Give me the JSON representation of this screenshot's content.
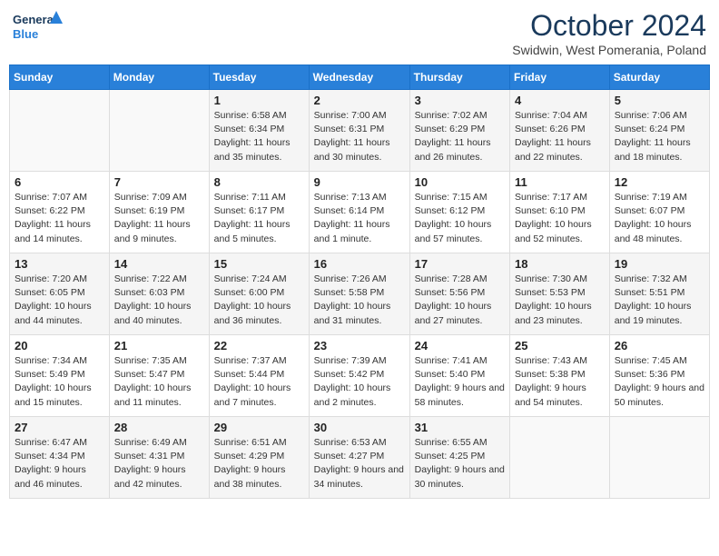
{
  "header": {
    "logo": {
      "general": "General",
      "blue": "Blue"
    },
    "title": "October 2024",
    "subtitle": "Swidwin, West Pomerania, Poland"
  },
  "days_of_week": [
    "Sunday",
    "Monday",
    "Tuesday",
    "Wednesday",
    "Thursday",
    "Friday",
    "Saturday"
  ],
  "weeks": [
    [
      null,
      null,
      {
        "day": 1,
        "sunrise": "6:58 AM",
        "sunset": "6:34 PM",
        "daylight": "11 hours and 35 minutes."
      },
      {
        "day": 2,
        "sunrise": "7:00 AM",
        "sunset": "6:31 PM",
        "daylight": "11 hours and 30 minutes."
      },
      {
        "day": 3,
        "sunrise": "7:02 AM",
        "sunset": "6:29 PM",
        "daylight": "11 hours and 26 minutes."
      },
      {
        "day": 4,
        "sunrise": "7:04 AM",
        "sunset": "6:26 PM",
        "daylight": "11 hours and 22 minutes."
      },
      {
        "day": 5,
        "sunrise": "7:06 AM",
        "sunset": "6:24 PM",
        "daylight": "11 hours and 18 minutes."
      }
    ],
    [
      {
        "day": 6,
        "sunrise": "7:07 AM",
        "sunset": "6:22 PM",
        "daylight": "11 hours and 14 minutes."
      },
      {
        "day": 7,
        "sunrise": "7:09 AM",
        "sunset": "6:19 PM",
        "daylight": "11 hours and 9 minutes."
      },
      {
        "day": 8,
        "sunrise": "7:11 AM",
        "sunset": "6:17 PM",
        "daylight": "11 hours and 5 minutes."
      },
      {
        "day": 9,
        "sunrise": "7:13 AM",
        "sunset": "6:14 PM",
        "daylight": "11 hours and 1 minute."
      },
      {
        "day": 10,
        "sunrise": "7:15 AM",
        "sunset": "6:12 PM",
        "daylight": "10 hours and 57 minutes."
      },
      {
        "day": 11,
        "sunrise": "7:17 AM",
        "sunset": "6:10 PM",
        "daylight": "10 hours and 52 minutes."
      },
      {
        "day": 12,
        "sunrise": "7:19 AM",
        "sunset": "6:07 PM",
        "daylight": "10 hours and 48 minutes."
      }
    ],
    [
      {
        "day": 13,
        "sunrise": "7:20 AM",
        "sunset": "6:05 PM",
        "daylight": "10 hours and 44 minutes."
      },
      {
        "day": 14,
        "sunrise": "7:22 AM",
        "sunset": "6:03 PM",
        "daylight": "10 hours and 40 minutes."
      },
      {
        "day": 15,
        "sunrise": "7:24 AM",
        "sunset": "6:00 PM",
        "daylight": "10 hours and 36 minutes."
      },
      {
        "day": 16,
        "sunrise": "7:26 AM",
        "sunset": "5:58 PM",
        "daylight": "10 hours and 31 minutes."
      },
      {
        "day": 17,
        "sunrise": "7:28 AM",
        "sunset": "5:56 PM",
        "daylight": "10 hours and 27 minutes."
      },
      {
        "day": 18,
        "sunrise": "7:30 AM",
        "sunset": "5:53 PM",
        "daylight": "10 hours and 23 minutes."
      },
      {
        "day": 19,
        "sunrise": "7:32 AM",
        "sunset": "5:51 PM",
        "daylight": "10 hours and 19 minutes."
      }
    ],
    [
      {
        "day": 20,
        "sunrise": "7:34 AM",
        "sunset": "5:49 PM",
        "daylight": "10 hours and 15 minutes."
      },
      {
        "day": 21,
        "sunrise": "7:35 AM",
        "sunset": "5:47 PM",
        "daylight": "10 hours and 11 minutes."
      },
      {
        "day": 22,
        "sunrise": "7:37 AM",
        "sunset": "5:44 PM",
        "daylight": "10 hours and 7 minutes."
      },
      {
        "day": 23,
        "sunrise": "7:39 AM",
        "sunset": "5:42 PM",
        "daylight": "10 hours and 2 minutes."
      },
      {
        "day": 24,
        "sunrise": "7:41 AM",
        "sunset": "5:40 PM",
        "daylight": "9 hours and 58 minutes."
      },
      {
        "day": 25,
        "sunrise": "7:43 AM",
        "sunset": "5:38 PM",
        "daylight": "9 hours and 54 minutes."
      },
      {
        "day": 26,
        "sunrise": "7:45 AM",
        "sunset": "5:36 PM",
        "daylight": "9 hours and 50 minutes."
      }
    ],
    [
      {
        "day": 27,
        "sunrise": "6:47 AM",
        "sunset": "4:34 PM",
        "daylight": "9 hours and 46 minutes."
      },
      {
        "day": 28,
        "sunrise": "6:49 AM",
        "sunset": "4:31 PM",
        "daylight": "9 hours and 42 minutes."
      },
      {
        "day": 29,
        "sunrise": "6:51 AM",
        "sunset": "4:29 PM",
        "daylight": "9 hours and 38 minutes."
      },
      {
        "day": 30,
        "sunrise": "6:53 AM",
        "sunset": "4:27 PM",
        "daylight": "9 hours and 34 minutes."
      },
      {
        "day": 31,
        "sunrise": "6:55 AM",
        "sunset": "4:25 PM",
        "daylight": "9 hours and 30 minutes."
      },
      null,
      null
    ]
  ]
}
